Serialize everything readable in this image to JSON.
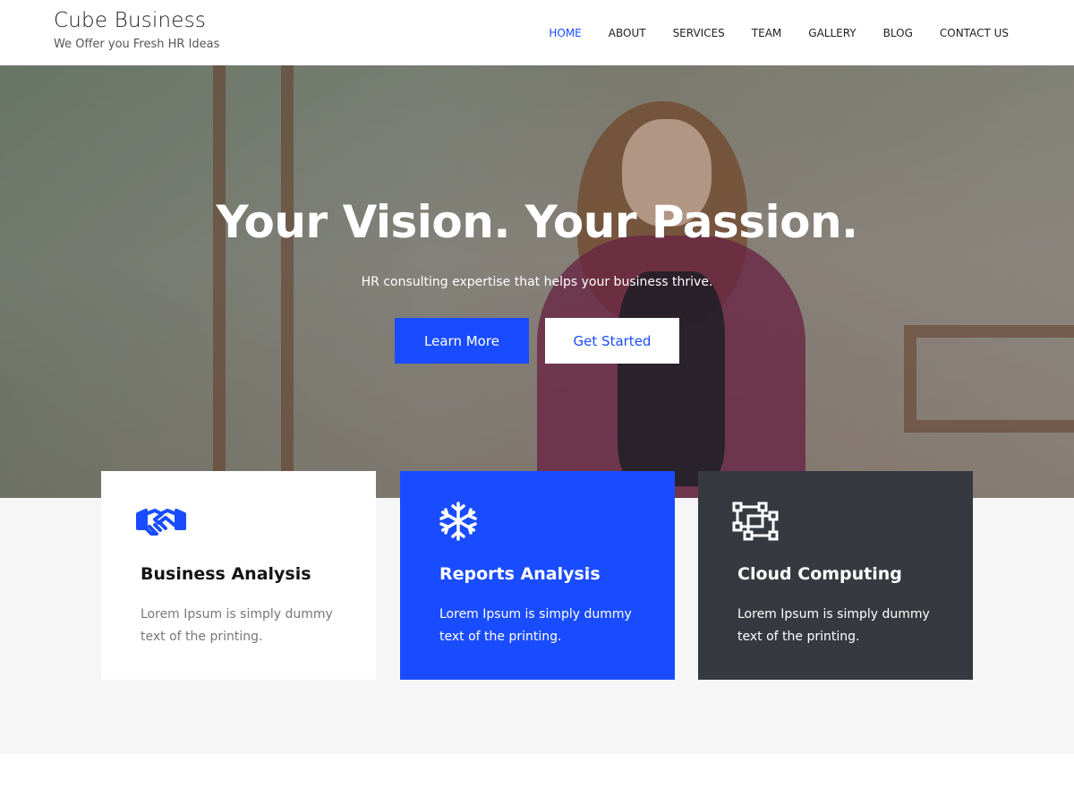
{
  "header": {
    "site_title": "Cube Business",
    "tagline": "We Offer you Fresh HR Ideas",
    "nav": [
      {
        "label": "HOME",
        "active": true
      },
      {
        "label": "ABOUT",
        "active": false
      },
      {
        "label": "SERVICES",
        "active": false
      },
      {
        "label": "TEAM",
        "active": false
      },
      {
        "label": "GALLERY",
        "active": false
      },
      {
        "label": "BLOG",
        "active": false
      },
      {
        "label": "CONTACT US",
        "active": false
      }
    ]
  },
  "hero": {
    "title": "Your Vision. Your Passion.",
    "subtitle": "HR consulting expertise that helps your business thrive.",
    "primary_button": "Learn More",
    "secondary_button": "Get Started"
  },
  "features": [
    {
      "icon": "handshake-icon",
      "title": "Business Analysis",
      "text": "Lorem Ipsum is simply dummy text of the printing."
    },
    {
      "icon": "snowflake-icon",
      "title": "Reports Analysis",
      "text": "Lorem Ipsum is simply dummy text of the printing."
    },
    {
      "icon": "cloud-nodes-icon",
      "title": "Cloud Computing",
      "text": "Lorem Ipsum is simply dummy text of the printing."
    }
  ],
  "colors": {
    "accent": "#1a4cff",
    "dark_card": "#363a40",
    "section_bg": "#f6f6f6"
  }
}
